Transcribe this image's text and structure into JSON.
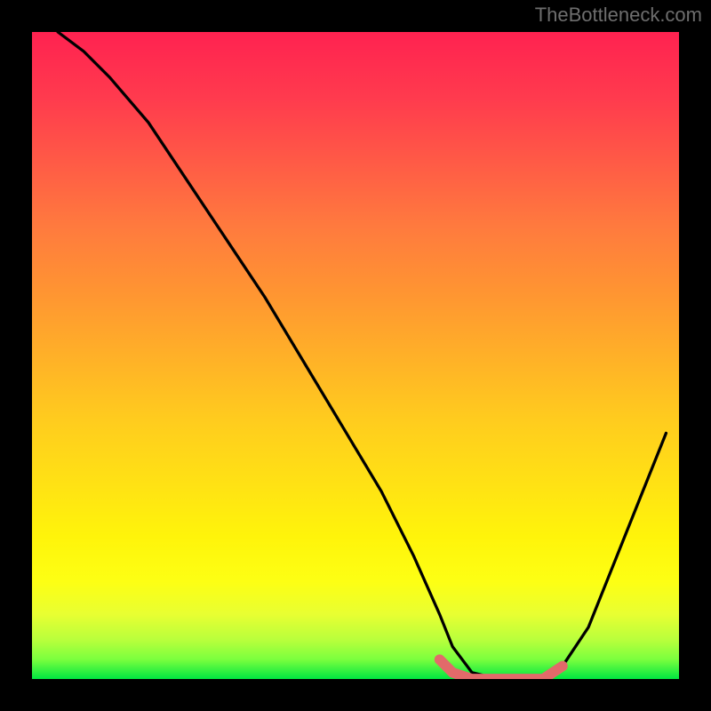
{
  "watermark": {
    "text": "TheBottleneck.com"
  },
  "colors": {
    "page_bg": "#000000",
    "watermark": "#6e6e6e",
    "curve_main": "#000000",
    "curve_accent": "#e26a6a",
    "gradient_top": "#ff2250",
    "gradient_bottom": "#00e641"
  },
  "chart_data": {
    "type": "line",
    "title": "",
    "xlabel": "",
    "ylabel": "",
    "xlim": [
      0,
      100
    ],
    "ylim": [
      0,
      100
    ],
    "legend": false,
    "grid": false,
    "series": [
      {
        "name": "bottleneck-curve",
        "color": "#000000",
        "x": [
          4,
          8,
          12,
          18,
          24,
          30,
          36,
          42,
          48,
          54,
          59,
          63,
          65,
          68,
          72,
          75,
          79,
          82,
          86,
          90,
          94,
          98
        ],
        "values": [
          100,
          97,
          93,
          86,
          77,
          68,
          59,
          49,
          39,
          29,
          19,
          10,
          5,
          1,
          0,
          0,
          0,
          2,
          8,
          18,
          28,
          38
        ]
      }
    ],
    "accent_segment": {
      "name": "valley-highlight",
      "color": "#e26a6a",
      "x": [
        63,
        65,
        68,
        72,
        75,
        79,
        82
      ],
      "values": [
        3,
        1,
        0,
        0,
        0,
        0,
        2
      ]
    }
  }
}
